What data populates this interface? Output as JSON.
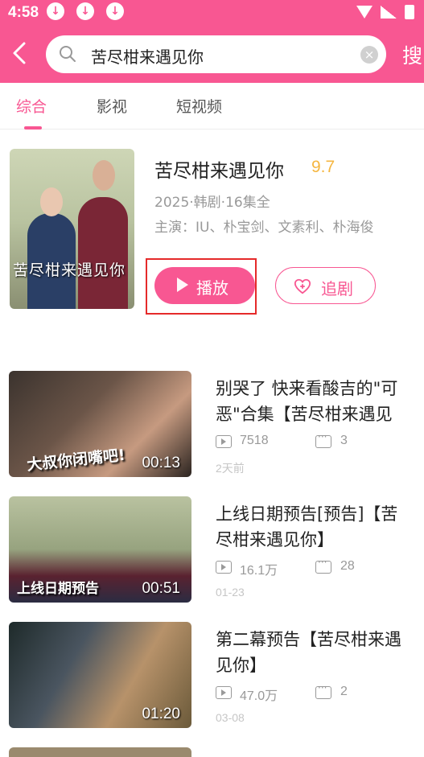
{
  "status_bar": {
    "time": "4:58"
  },
  "search": {
    "query": "苦尽柑来遇见你",
    "submit_label": "搜"
  },
  "tabs": [
    {
      "label": "综合",
      "active": true
    },
    {
      "label": "影视",
      "active": false
    },
    {
      "label": "短视频",
      "active": false
    }
  ],
  "feature": {
    "poster_text": "苦尽柑来遇见你",
    "title": "苦尽柑来遇见你",
    "score": "9.7",
    "meta": "2025·韩剧·16集全",
    "cast": "主演：IU、朴宝剑、文素利、朴海俊",
    "play_label": "播放",
    "follow_label": "追剧"
  },
  "videos": [
    {
      "title": "别哭了 快来看酸吉的\"可\n恶\"合集【苦尽柑来遇见",
      "plays": "7518",
      "comments": "3",
      "date": "2天前",
      "duration": "00:13",
      "caption": "大叔你闭嘴吧!"
    },
    {
      "title": "上线日期预告[预告]【苦\n尽柑来遇见你】",
      "plays": "16.1万",
      "comments": "28",
      "date": "01-23",
      "duration": "00:51",
      "caption": "上线日期预告"
    },
    {
      "title": "第二幕预告【苦尽柑来遇\n见你】",
      "plays": "47.0万",
      "comments": "2",
      "date": "03-08",
      "duration": "01:20",
      "caption": ""
    }
  ],
  "colors": {
    "accent": "#f85792",
    "score": "#f5b640",
    "highlight": "#e52a2a"
  }
}
